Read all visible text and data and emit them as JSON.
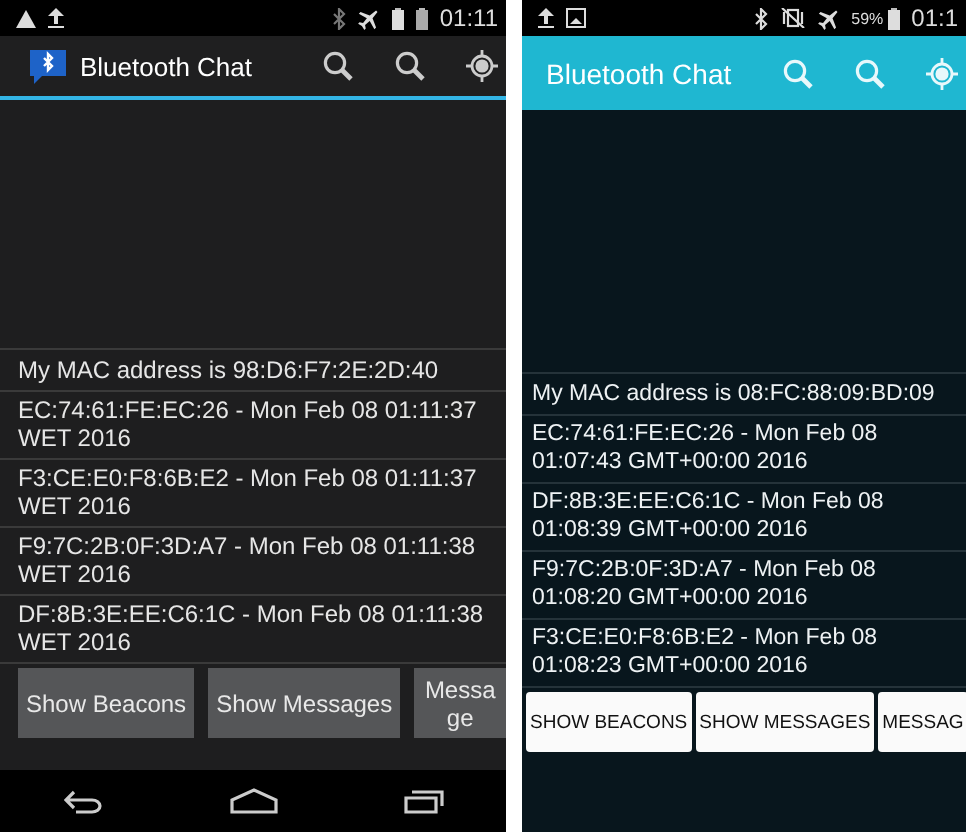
{
  "phones": [
    {
      "kind": "holo",
      "status_bar": {
        "time": "01:11"
      },
      "title": "Bluetooth Chat",
      "messages": [
        {
          "text": "My MAC address is 98:D6:F7:2E:2D:40"
        },
        {
          "text": "EC:74:61:FE:EC:26 - Mon Feb 08 01:11:37 WET 2016"
        },
        {
          "text": "F3:CE:E0:F8:6B:E2 - Mon Feb 08 01:11:37 WET 2016"
        },
        {
          "text": "F9:7C:2B:0F:3D:A7 - Mon Feb 08 01:11:38 WET 2016"
        },
        {
          "text": "DF:8B:3E:EE:C6:1C - Mon Feb 08 01:11:38 WET 2016"
        }
      ],
      "buttons": [
        "Show Beacons",
        "Show Messages",
        "Message"
      ]
    },
    {
      "kind": "material",
      "status_bar": {
        "battery": "59%",
        "time": "01:1"
      },
      "title": "Bluetooth Chat",
      "messages": [
        {
          "text": "My MAC address is 08:FC:88:09:BD:09"
        },
        {
          "text": "EC:74:61:FE:EC:26 - Mon Feb 08 01:07:43 GMT+00:00 2016"
        },
        {
          "text": "DF:8B:3E:EE:C6:1C - Mon Feb 08 01:08:39 GMT+00:00 2016"
        },
        {
          "text": "F9:7C:2B:0F:3D:A7 - Mon Feb 08 01:08:20 GMT+00:00 2016"
        },
        {
          "text": "F3:CE:E0:F8:6B:E2 - Mon Feb 08 01:08:23 GMT+00:00 2016"
        }
      ],
      "buttons": [
        "SHOW BEACONS",
        "SHOW MESSAGES",
        "MESSAG"
      ]
    }
  ]
}
